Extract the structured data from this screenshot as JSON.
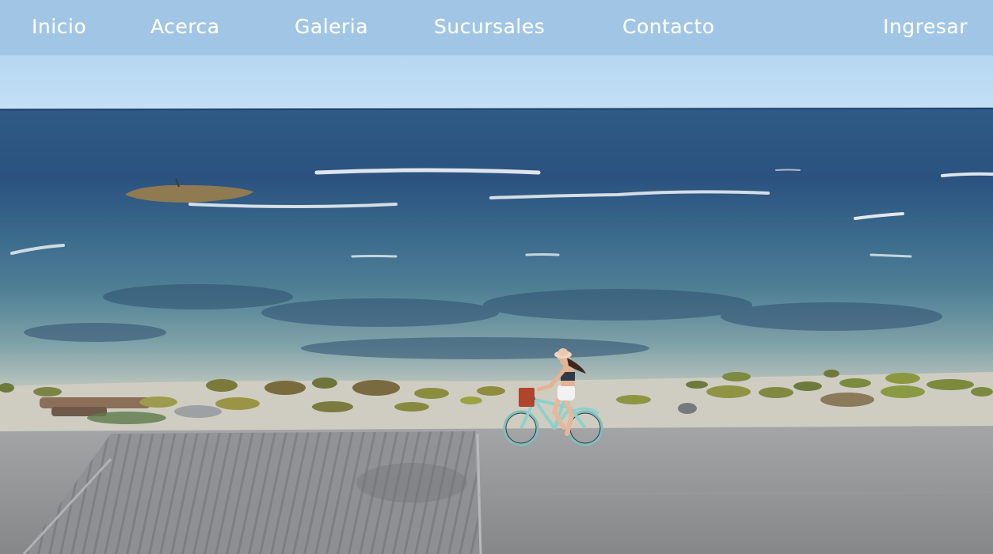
{
  "nav": {
    "items": [
      {
        "label": "Inicio"
      },
      {
        "label": "Acerca"
      },
      {
        "label": "Galeria"
      },
      {
        "label": "Sucursales"
      },
      {
        "label": "Contacto"
      }
    ],
    "login_label": "Ingresar"
  },
  "hero": {
    "media": "background-video-beach-cyclist",
    "colors": {
      "sky": "#b9d9f2",
      "sea_deep": "#25456e",
      "sea_shallow": "#6f9aa6",
      "sand": "#c9c6b8",
      "road": "#8f9195"
    }
  }
}
